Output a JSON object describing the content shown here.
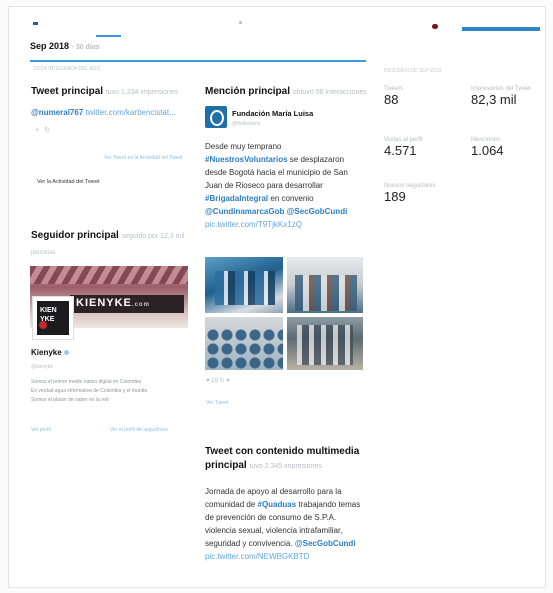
{
  "header": {
    "date": "Sep 2018",
    "date_suffix": "· 30 días"
  },
  "section_label": "VISTA INTEGRADA DEL MES",
  "top_tweet": {
    "title": "Tweet principal",
    "title_suffix": "tuvo 1.234 impresiones",
    "handle": "@numeral767",
    "link": "twitter.com/karbencistat...",
    "view_link": "Ver Tweet en la Actividad del Tweet",
    "activity_label": "Ver la Actividad del Tweet"
  },
  "top_follower": {
    "title": "Seguidor principal",
    "title_suffix": "seguido por 12,3 mil",
    "subtitle": "personas",
    "banner_text": "KIENYKE",
    "banner_suffix": ".com",
    "logo_text": "KIEN\nYKE",
    "name": "Kienyke",
    "handle": "@kienyke",
    "bio_1": "Somos el primer medio nativo digital en Colombia",
    "bio_2": "Es verdad agua informativa de Colombia y el mundo.",
    "bio_3": "Somos el placer de saber en la red",
    "view_profile": "Ver perfil",
    "view_followers": "Ver el perfil de seguidores"
  },
  "top_mention": {
    "title": "Mención principal",
    "title_suffix": "obtuvo 56 interacciones",
    "account_name": "Fundación María Luisa",
    "account_handle": "@fmlmoreno",
    "text_1": "Desde muy temprano",
    "hashtag_1": "#NuestrosVoluntarios",
    "text_2": "se desplazaron desde Bogotá hacia el municipio de San Juan de Rioseco para desarrollar",
    "hashtag_2": "#BrigadaIntegral",
    "text_3": "en convenio",
    "mention_1": "@CundinamarcaGob",
    "mention_2": "@SecGobCundi",
    "link": "pic.twitter.com/T9TjkKx1zQ",
    "actions": "♥ 15  ↻  ♥",
    "view_link": "Ver Tweet"
  },
  "media_tweet": {
    "title_line1": "Tweet con contenido multimedia",
    "title_line2": "principal",
    "title_suffix": "tuvo 2.345 impresiones",
    "text_1": "Jornada de apoyo al desarrollo para la comunidad de",
    "hashtag": "#Quaduas",
    "text_2": "trabajando temas de prevención de consumo de S.P.A. violencia sexual, violencia intrafamiliar, seguridad y convivencia.",
    "mention": "@SecGobCundi",
    "link": "pic.twitter.com/NEWBGKBTD"
  },
  "summary": {
    "title": "RESUMEN DE SEP 2018",
    "stats": [
      {
        "label": "Tweets",
        "value": "88"
      },
      {
        "label": "Impresiones del Tweet",
        "value": "82,3 mil"
      },
      {
        "label": "Visitas al perfil",
        "value": "4.571"
      },
      {
        "label": "Menciones",
        "value": "1.064"
      },
      {
        "label": "Nuevos seguidores",
        "value": "189"
      }
    ]
  },
  "colors": {
    "accent": "#3a9ad9",
    "hashtag": "#2a7fc4",
    "muted": "#b9bec3"
  }
}
